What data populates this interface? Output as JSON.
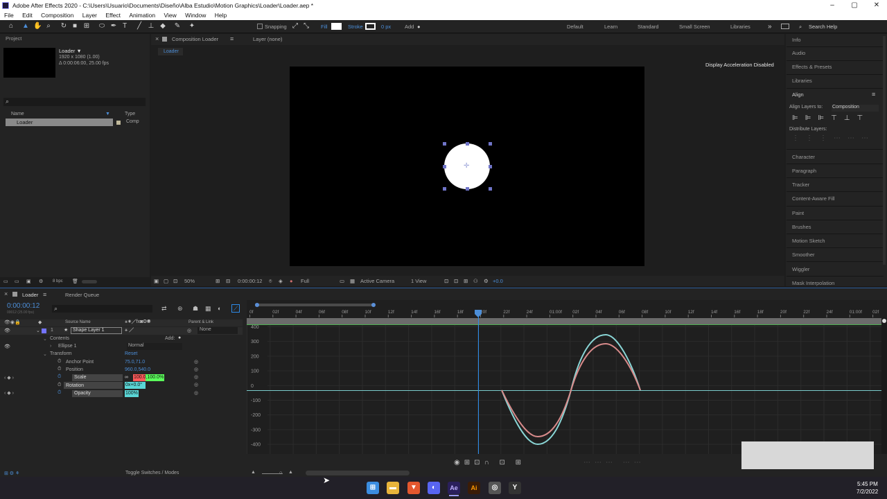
{
  "window": {
    "title": "Adobe After Effects 2020 - C:\\Users\\Usuario\\Documents\\Diseño\\Alba Estudio\\Motion Graphics\\Loader\\Loader.aep *",
    "minimize": "–",
    "maximize": "▢",
    "close": "✕"
  },
  "menu": [
    "File",
    "Edit",
    "Composition",
    "Layer",
    "Effect",
    "Animation",
    "View",
    "Window",
    "Help"
  ],
  "toolbar": {
    "snapping": "Snapping",
    "fill": "Fill",
    "stroke": "Stroke",
    "stroke_width": "0 px",
    "add": "Add",
    "workspaces": [
      "Default",
      "Learn",
      "Standard",
      "Small Screen",
      "Libraries"
    ],
    "more": "»",
    "search": "Search Help"
  },
  "project": {
    "title": "Project",
    "item_name": "Loader ▼",
    "item_res": "1920 x 1080 (1.00)",
    "item_dur": "Δ 0:00:06:00, 25.00 fps",
    "col_name": "Name",
    "col_type": "Type",
    "row_name": "Loader",
    "row_type": "Comp",
    "bpc": "8 bpc"
  },
  "comp": {
    "tab": "Composition Loader",
    "layer_tab": "Layer (none)",
    "breadcrumb": "Loader",
    "accel": "Display Acceleration Disabled",
    "zoom": "50%",
    "time": "0:00:00:12",
    "quality": "Full",
    "camera": "Active Camera",
    "views": "1 View",
    "offset": "+0.0"
  },
  "right": {
    "items": [
      "Info",
      "Audio",
      "Effects & Presets",
      "Libraries",
      "Align"
    ],
    "align_to_label": "Align Layers to:",
    "align_to": "Composition",
    "distribute": "Distribute Layers:",
    "items2": [
      "Character",
      "Paragraph",
      "Tracker",
      "Content-Aware Fill",
      "Paint",
      "Brushes",
      "Motion Sketch",
      "Smoother",
      "Wiggler",
      "Mask Interpolation"
    ]
  },
  "timeline": {
    "tab": "Loader",
    "render_tab": "Render Queue",
    "time": "0:00:00:12",
    "frames": "00012 (25.00 fps)",
    "col_source": "Source Name",
    "col_parent": "Parent & Link",
    "layer_num": "1",
    "layer_name": "Shape Layer 1",
    "parent": "None",
    "contents": "Contents",
    "add": "Add:",
    "ellipse": "Ellipse 1",
    "blend": "Normal",
    "transform": "Transform",
    "reset": "Reset",
    "props": [
      {
        "name": "Anchor Point",
        "value": "75.0,71.0"
      },
      {
        "name": "Position",
        "value": "960.0,540.0"
      },
      {
        "name": "Scale",
        "value": "100.0,100.0%"
      },
      {
        "name": "Rotation",
        "value": "0x+0.0°"
      },
      {
        "name": "Opacity",
        "value": "100%"
      }
    ],
    "toggle": "Toggle Switches / Modes"
  },
  "ruler": [
    "0f",
    "02f",
    "04f",
    "06f",
    "08f",
    "10f",
    "12f",
    "14f",
    "16f",
    "18f",
    "20f",
    "22f",
    "24f",
    "01:00f",
    "02f",
    "04f",
    "06f",
    "08f",
    "10f",
    "12f",
    "14f",
    "16f",
    "18f",
    "20f",
    "22f",
    "24f",
    "01:00f",
    "02f",
    "04f",
    "06f"
  ],
  "graph": {
    "y_ticks": [
      "400",
      "300",
      "200",
      "100",
      "0",
      "-100",
      "-200",
      "-300",
      "-400"
    ]
  },
  "taskbar": {
    "time": "5:45 PM",
    "date": "7/2/2022"
  },
  "colors": {
    "accent": "#2d8ceb",
    "layer_label": "#7373ff",
    "graph_red": "#d88b8b",
    "graph_cyan": "#8ad6d6",
    "scale_hl": "#ff5a5a",
    "scale_hl2": "#5aff5a"
  }
}
